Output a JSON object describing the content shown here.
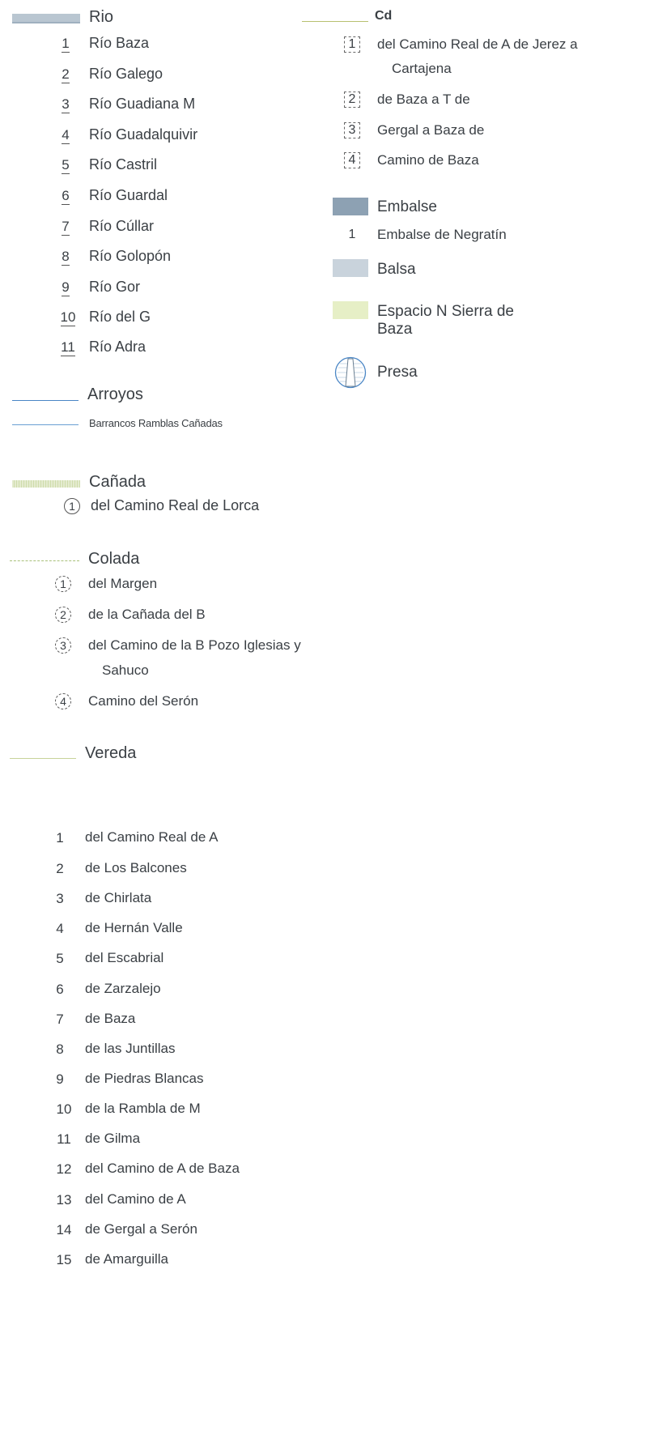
{
  "rio": {
    "title": "Rio",
    "items": [
      {
        "n": "1",
        "label": "Río Baza"
      },
      {
        "n": "2",
        "label": "Río Galego"
      },
      {
        "n": "3",
        "label": "Río Guadiana M"
      },
      {
        "n": "4",
        "label": "Río Guadalquivir"
      },
      {
        "n": "5",
        "label": "Río Castril"
      },
      {
        "n": "6",
        "label": "Río Guardal"
      },
      {
        "n": "7",
        "label": "Río Cúllar"
      },
      {
        "n": "8",
        "label": "Río Golopón"
      },
      {
        "n": "9",
        "label": "Río Gor"
      },
      {
        "n": "10",
        "label": "Río del G"
      },
      {
        "n": "11",
        "label": "Río Adra"
      }
    ]
  },
  "arroyos": {
    "title": "Arroyos",
    "sub": "Barrancos  Ramblas  Cañadas"
  },
  "canada": {
    "title": "Cañada",
    "items": [
      {
        "n": "1",
        "label": "del Camino Real de Lorca"
      }
    ]
  },
  "colada": {
    "title": "Colada",
    "items": [
      {
        "n": "1",
        "label": "del Margen"
      },
      {
        "n": "2",
        "label": "de la Cañada del B"
      },
      {
        "n": "3",
        "label": "del Camino de la B Pozo Iglesias y",
        "label2": "Sahuco"
      },
      {
        "n": "4",
        "label": "Camino del Serón"
      }
    ]
  },
  "vereda": {
    "title": "Vereda",
    "items": [
      {
        "n": "1",
        "label": "del Camino Real de A"
      },
      {
        "n": "2",
        "label": "de Los Balcones"
      },
      {
        "n": "3",
        "label": "de Chirlata"
      },
      {
        "n": "4",
        "label": "de Hernán Valle"
      },
      {
        "n": "5",
        "label": "del Escabrial"
      },
      {
        "n": "6",
        "label": "de Zarzalejo"
      },
      {
        "n": "7",
        "label": "de Baza"
      },
      {
        "n": "8",
        "label": "de las Juntillas"
      },
      {
        "n": "9",
        "label": "de Piedras Blancas"
      },
      {
        "n": "10",
        "label": "de la Rambla de M"
      },
      {
        "n": "11",
        "label": "de Gilma"
      },
      {
        "n": "12",
        "label": "del Camino de A de Baza"
      },
      {
        "n": "13",
        "label": "del Camino de A"
      },
      {
        "n": "14",
        "label": "de Gergal a Serón"
      },
      {
        "n": "15",
        "label": "de Amarguilla"
      }
    ]
  },
  "cordel": {
    "title": "Cd",
    "items": [
      {
        "n": "1",
        "label": "del Camino Real de A de Jerez a",
        "label2": "Cartajena"
      },
      {
        "n": "2",
        "label": "de Baza a T de"
      },
      {
        "n": "3",
        "label": "Gergal a  Baza de"
      },
      {
        "n": "4",
        "label": "Camino de  Baza"
      }
    ]
  },
  "embalse": {
    "title": "Embalse",
    "items": [
      {
        "n": "1",
        "label": "Embalse de Negratín"
      }
    ]
  },
  "balsa": {
    "title": "Balsa"
  },
  "espacio": {
    "title": "Espacio N Sierra de",
    "title2": "Baza"
  },
  "presa": {
    "title": "Presa"
  },
  "colors": {
    "rio": "#b9c6d1",
    "arroyo": "#4a86c5",
    "canada": "#dfe8c8",
    "colada": "#a9c07a",
    "vereda": "#c8d39a",
    "embalse": "#8da1b3",
    "balsa": "#c9d3dc",
    "espacio": "#e6efc6"
  }
}
